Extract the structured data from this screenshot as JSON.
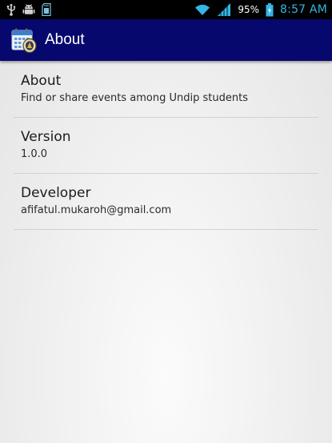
{
  "status_bar": {
    "icons_left": [
      "usb-icon",
      "android-debug-icon",
      "sd-card-icon"
    ],
    "icons_right": [
      "wifi-icon",
      "signal-icon",
      "battery-icon"
    ],
    "battery_percent": "95%",
    "time": "8:57 AM",
    "time_color": "#33b5e5"
  },
  "action_bar": {
    "title": "About",
    "icon": "calendar-icon",
    "color": "#06086e"
  },
  "items": [
    {
      "title": "About",
      "subtitle": "Find or share events among Undip students"
    },
    {
      "title": "Version",
      "subtitle": "1.0.0"
    },
    {
      "title": "Developer",
      "subtitle": "afifatul.mukaroh@gmail.com"
    }
  ]
}
